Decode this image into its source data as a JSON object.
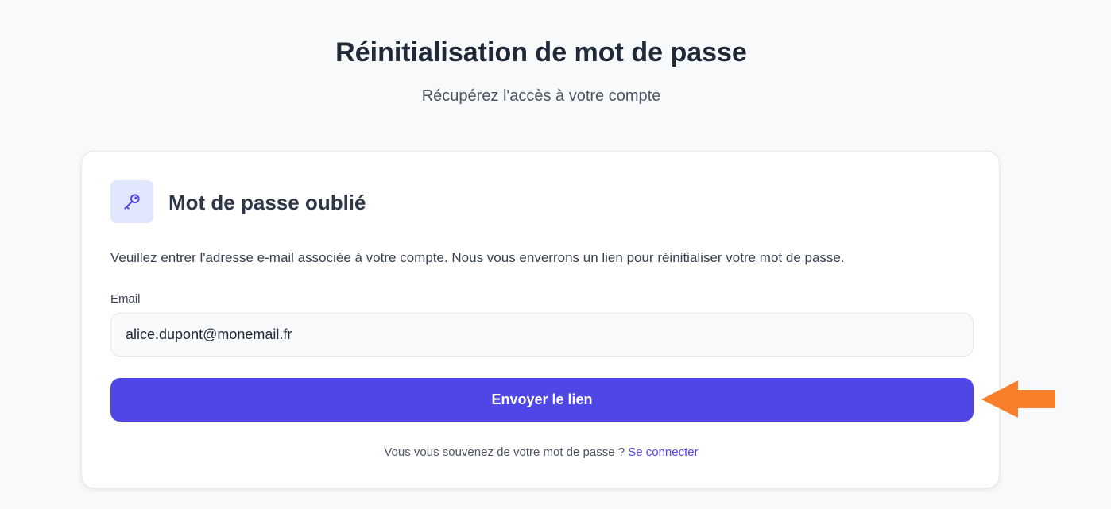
{
  "header": {
    "title": "Réinitialisation de mot de passe",
    "subtitle": "Récupérez l'accès à votre compte"
  },
  "card": {
    "icon": "key-icon",
    "title": "Mot de passe oublié",
    "description": "Veuillez entrer l'adresse e-mail associée à votre compte. Nous vous enverrons un lien pour réinitialiser votre mot de passe.",
    "email_label": "Email",
    "email_value": "alice.dupont@monemail.fr",
    "submit_label": "Envoyer le lien",
    "footer_text": "Vous vous souvenez de votre mot de passe ?",
    "footer_link": "Se connecter"
  },
  "annotation": {
    "icon": "arrow-left-icon",
    "color": "#f97f2b"
  },
  "colors": {
    "accent": "#4f46e5",
    "icon_bg": "#e0e7ff",
    "background": "#f8f9fb"
  }
}
